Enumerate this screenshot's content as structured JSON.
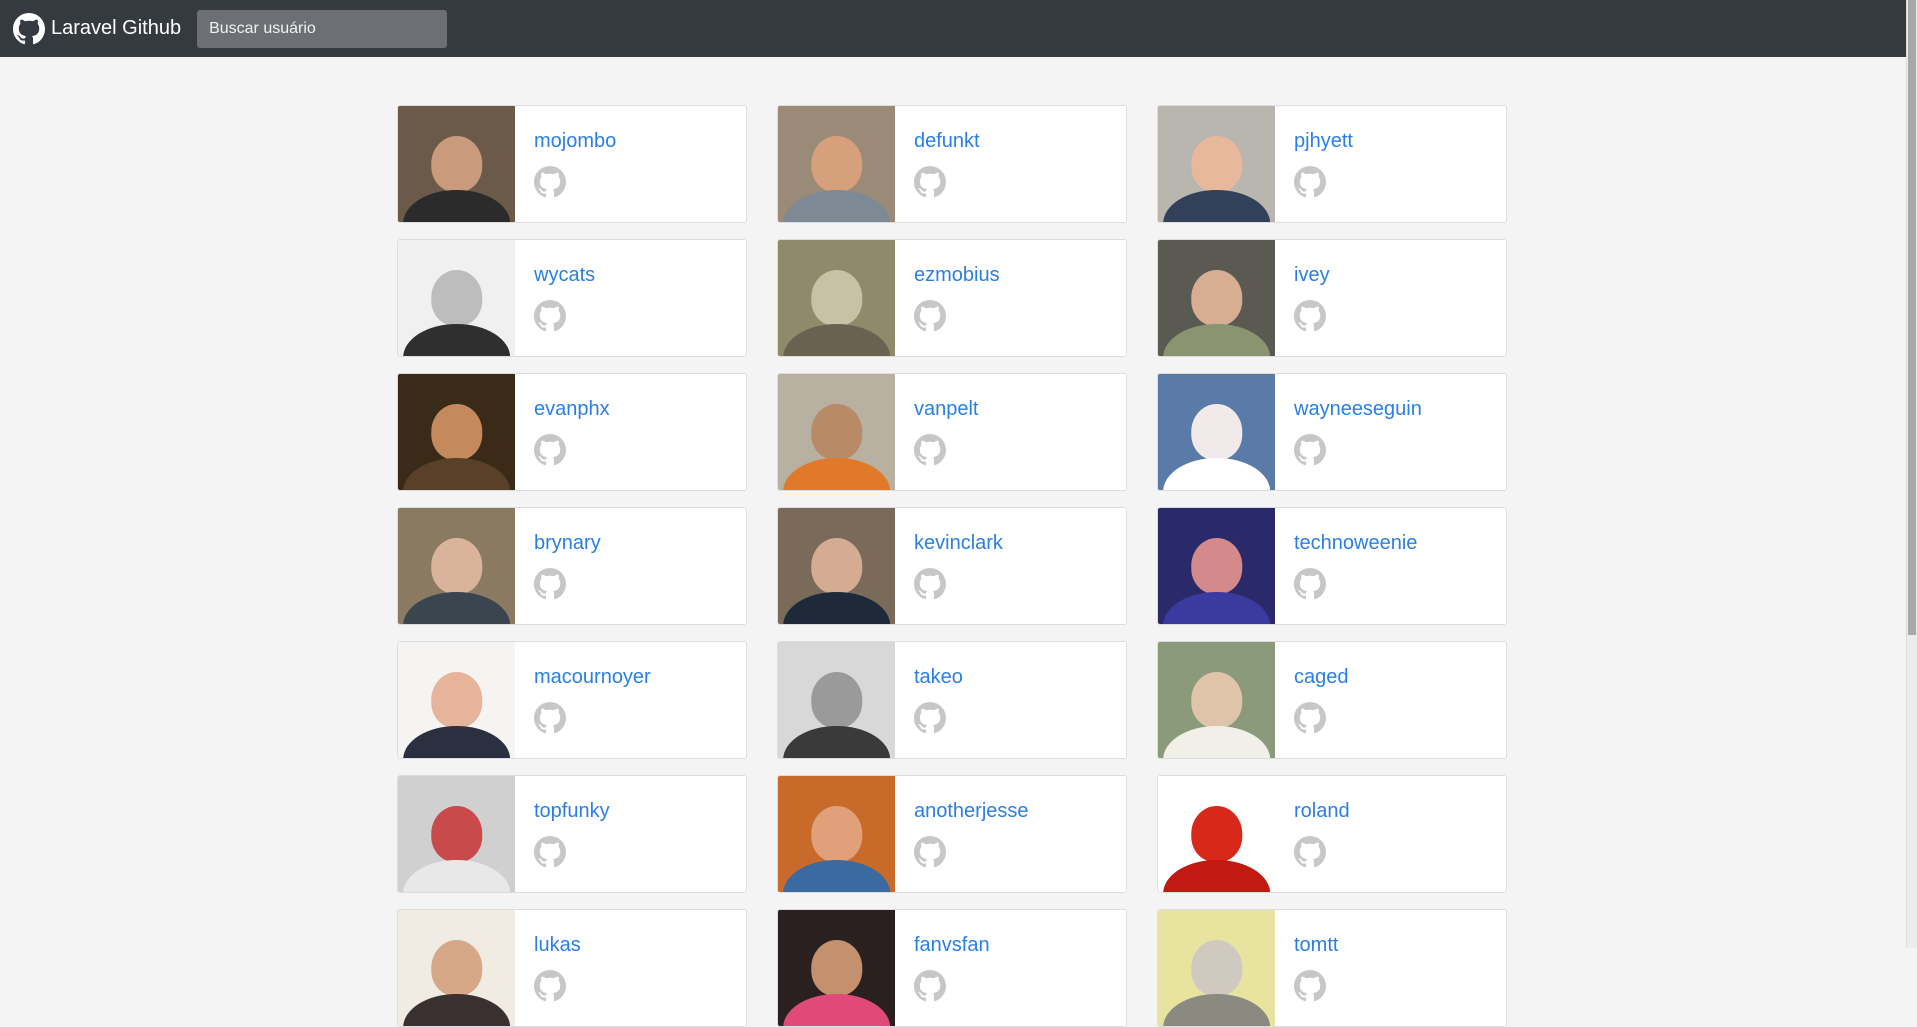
{
  "app": {
    "title": "Laravel Github",
    "search_placeholder": "Buscar usuário"
  },
  "colors": {
    "navbar": "#343a40",
    "link": "#2a7ee8",
    "github_icon": "#c7c7c7",
    "background": "#f4f4f4"
  },
  "users": [
    {
      "login": "mojombo",
      "avatar": [
        "#6b5a4a",
        "#c99a7c",
        "#2b2b2b"
      ]
    },
    {
      "login": "defunkt",
      "avatar": [
        "#9a8a78",
        "#d7a07c",
        "#7d8a96"
      ]
    },
    {
      "login": "pjhyett",
      "avatar": [
        "#b9b6b0",
        "#e7b89c",
        "#33405a"
      ]
    },
    {
      "login": "wycats",
      "avatar": [
        "#f0f0f0",
        "#bdbdbd",
        "#2f2f2f"
      ]
    },
    {
      "login": "ezmobius",
      "avatar": [
        "#8f8a6a",
        "#c7c2a6",
        "#6a6250"
      ]
    },
    {
      "login": "ivey",
      "avatar": [
        "#5a5a52",
        "#d8ae92",
        "#8a9470"
      ]
    },
    {
      "login": "evanphx",
      "avatar": [
        "#3a2a18",
        "#c48a5c",
        "#5a4028"
      ]
    },
    {
      "login": "vanpelt",
      "avatar": [
        "#b8b0a0",
        "#b98a66",
        "#e07a2a"
      ]
    },
    {
      "login": "wayneeseguin",
      "avatar": [
        "#5a7aa8",
        "#f2eaea",
        "#ffffff"
      ]
    },
    {
      "login": "brynary",
      "avatar": [
        "#8a7a62",
        "#d9b49a",
        "#3a4550"
      ]
    },
    {
      "login": "kevinclark",
      "avatar": [
        "#7a6a5a",
        "#d4ac92",
        "#1e2a3a"
      ]
    },
    {
      "login": "technoweenie",
      "avatar": [
        "#2a2a6a",
        "#d48a8a",
        "#3a3aa0"
      ]
    },
    {
      "login": "macournoyer",
      "avatar": [
        "#f6f4f2",
        "#e6b49a",
        "#2a3040"
      ]
    },
    {
      "login": "takeo",
      "avatar": [
        "#d8d8d8",
        "#9a9a9a",
        "#3a3a3a"
      ]
    },
    {
      "login": "caged",
      "avatar": [
        "#8a9a7a",
        "#e0c4aa",
        "#f0f0e8"
      ]
    },
    {
      "login": "topfunky",
      "avatar": [
        "#d0d0d0",
        "#c84a4a",
        "#e8e8e8"
      ]
    },
    {
      "login": "anotherjesse",
      "avatar": [
        "#c86a2a",
        "#e0a07a",
        "#3a6aa0"
      ]
    },
    {
      "login": "roland",
      "avatar": [
        "#ffffff",
        "#d8281a",
        "#c21a10"
      ]
    },
    {
      "login": "lukas",
      "avatar": [
        "#f0ece4",
        "#d6a888",
        "#3a3030"
      ]
    },
    {
      "login": "fanvsfan",
      "avatar": [
        "#2a2020",
        "#c4906e",
        "#e04a7a"
      ]
    },
    {
      "login": "tomtt",
      "avatar": [
        "#e8e4a0",
        "#cfc9c0",
        "#8a8a80"
      ]
    }
  ]
}
